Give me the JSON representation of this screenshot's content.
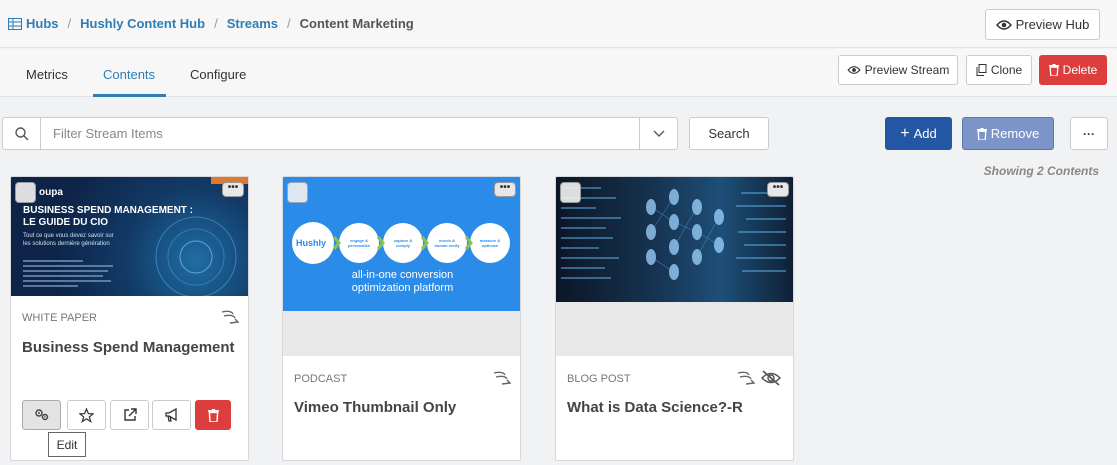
{
  "breadcrumb": {
    "items": [
      "Hubs",
      "Hushly Content Hub",
      "Streams"
    ],
    "current": "Content Marketing"
  },
  "header": {
    "preview_hub": "Preview Hub"
  },
  "tabs": [
    "Metrics",
    "Contents",
    "Configure"
  ],
  "toolbar": {
    "preview_stream": "Preview Stream",
    "clone": "Clone",
    "delete": "Delete"
  },
  "search": {
    "placeholder": "Filter Stream Items",
    "button": "Search"
  },
  "actions": {
    "add": "Add",
    "remove": "Remove",
    "more": "···"
  },
  "showing": "Showing 2 Contents",
  "cards": [
    {
      "type": "WHITE PAPER",
      "title": "Business Spend Management",
      "thumb": {
        "brand": "oupa",
        "badge": "",
        "heading1": "BUSINESS SPEND MANAGEMENT :",
        "heading2": "LE GUIDE DU CIO",
        "sub1": "Tout ce que vous devez savoir sur",
        "sub2": "les solutions dernière génération"
      }
    },
    {
      "type": "PODCAST",
      "title": "Vimeo Thumbnail Only",
      "thumb": {
        "brand": "Hushly",
        "steps": [
          "engage & personalize",
          "capture & comply",
          "enrich & human-verify",
          "measure & optimize"
        ],
        "tagline1": "all-in-one conversion",
        "tagline2": "optimization platform"
      }
    },
    {
      "type": "BLOG POST",
      "title": "What is Data Science?-R"
    }
  ],
  "card_actions_tooltip": "Edit",
  "colors": {
    "accent": "#2f7db4",
    "add": "#2457a3",
    "remove": "#7c94c8",
    "delete": "#dc3e3e",
    "hushly_blue": "#2b8be8"
  }
}
